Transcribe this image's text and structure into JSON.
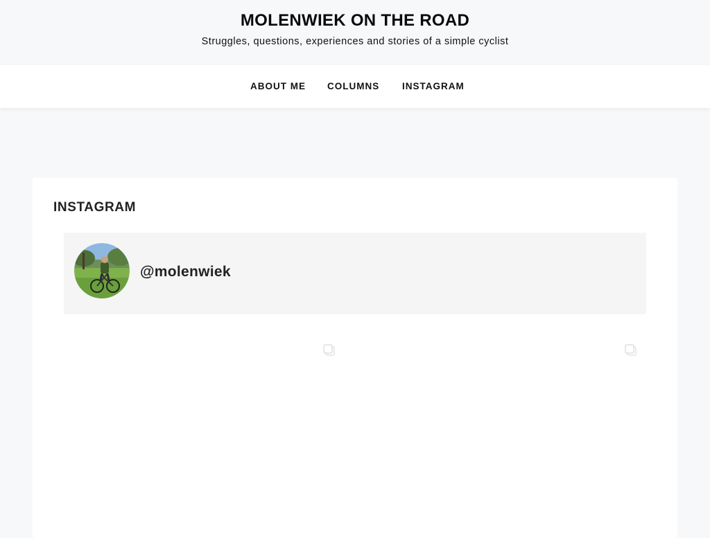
{
  "site": {
    "title": "MOLENWIEK ON THE ROAD",
    "tagline": "Struggles, questions, experiences and stories of a simple cyclist"
  },
  "nav": {
    "items": [
      {
        "label": "ABOUT ME"
      },
      {
        "label": "COLUMNS"
      },
      {
        "label": "INSTAGRAM"
      }
    ]
  },
  "main": {
    "heading": "INSTAGRAM",
    "profile": {
      "username": "@molenwiek",
      "avatar_icon": "cyclist-avatar"
    },
    "gallery": {
      "tiles": [
        {
          "icon": "carousel-icon"
        },
        {
          "icon": "carousel-icon"
        }
      ]
    }
  },
  "colors": {
    "page_background": "#f7f8fa",
    "nav_background": "#ffffff",
    "card_background": "#ffffff",
    "profile_box_background": "#f5f5f6",
    "text": "#111111"
  }
}
